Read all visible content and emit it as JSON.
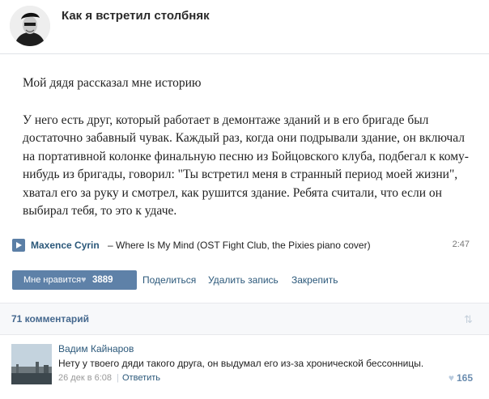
{
  "header": {
    "title": "Как я встретил столбняк"
  },
  "post": {
    "paragraph_1": "Мой дядя рассказал мне историю",
    "paragraph_2": "У него есть друг, который работает в демонтаже зданий и в его бригаде был достаточно забавный чувак. Каждый раз, когда они подрывали здание, он включал на портативной колонке финальную песню из Бойцовского клуба, подбегал к кому-нибудь из бригады, говорил: \"Ты встретил меня в странный период моей жизни\", хватал его за руку и смотрел, как рушится здание. Ребята считали, что если он выбирал тебя, то это к удаче."
  },
  "audio": {
    "artist": "Maxence Cyrin",
    "title": "– Where Is My Mind (OST Fight Club, the Pixies piano cover)",
    "duration": "2:47",
    "icon": "play-icon"
  },
  "actions": {
    "like_label": "Мне нравится",
    "like_count": "3889",
    "share": "Поделиться",
    "delete": "Удалить запись",
    "pin": "Закрепить"
  },
  "comments": {
    "count_label": "71 комментарий",
    "items": [
      {
        "author": "Вадим Кайнаров",
        "text": "Нету у твоего дяди такого друга, он выдумал его из-за хронической бессонницы.",
        "date": "26 дек в 6:08",
        "reply": "Ответить",
        "likes": "165"
      }
    ]
  },
  "colors": {
    "link": "#2b587a",
    "like_button": "#5e81a8",
    "comments_bar": "#f7f8fa"
  }
}
